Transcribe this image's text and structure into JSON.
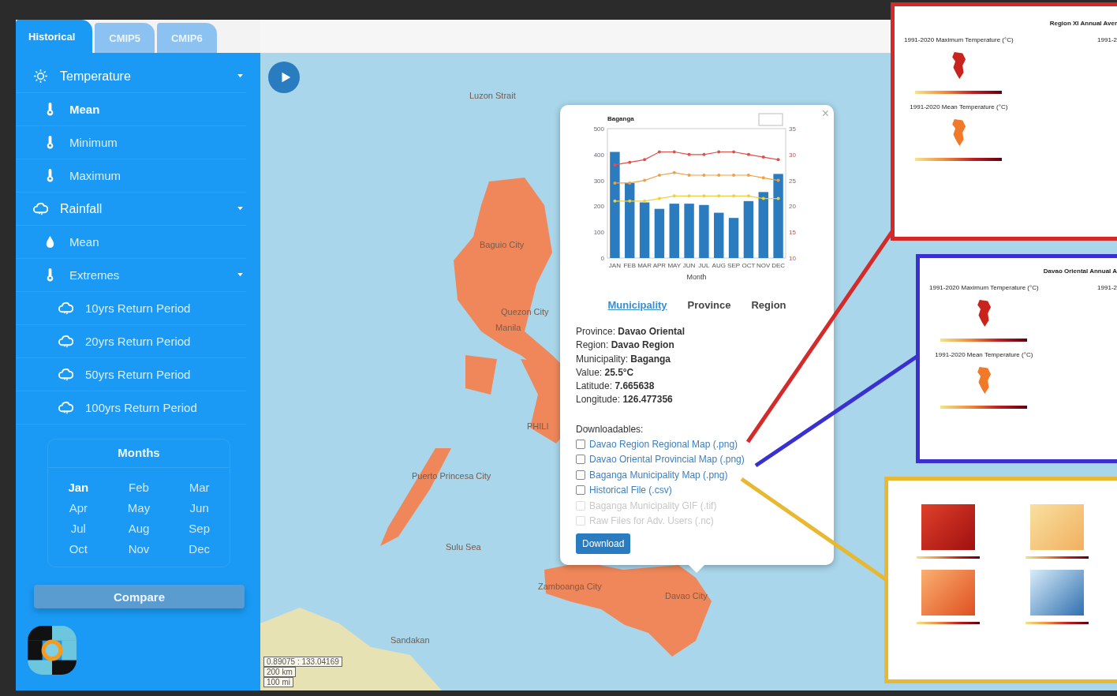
{
  "tabs": [
    {
      "label": "Historical",
      "selected": true
    },
    {
      "label": "CMIP5",
      "selected": false
    },
    {
      "label": "CMIP6",
      "selected": false
    }
  ],
  "sidebar": {
    "menu": [
      {
        "label": "Temperature",
        "selected": false,
        "expanded": true,
        "children": [
          {
            "label": "Mean",
            "selected": true
          },
          {
            "label": "Minimum",
            "selected": false
          },
          {
            "label": "Maximum",
            "selected": false
          }
        ]
      },
      {
        "label": "Rainfall",
        "selected": false,
        "expanded": true,
        "children": [
          {
            "label": "Mean",
            "selected": false
          },
          {
            "label": "Extremes",
            "selected": false,
            "expanded": true,
            "children": [
              {
                "label": "10yrs Return Period",
                "selected": false
              },
              {
                "label": "20yrs Return Period",
                "selected": false
              },
              {
                "label": "50yrs Return Period",
                "selected": false
              },
              {
                "label": "100yrs Return Period",
                "selected": false
              }
            ]
          }
        ]
      }
    ],
    "months_title": "Months",
    "months": [
      {
        "label": "Jan",
        "selected": true
      },
      {
        "label": "Feb",
        "selected": false
      },
      {
        "label": "Mar",
        "selected": false
      },
      {
        "label": "Apr",
        "selected": false
      },
      {
        "label": "May",
        "selected": false
      },
      {
        "label": "Jun",
        "selected": false
      },
      {
        "label": "Jul",
        "selected": false
      },
      {
        "label": "Aug",
        "selected": false
      },
      {
        "label": "Sep",
        "selected": false
      },
      {
        "label": "Oct",
        "selected": false
      },
      {
        "label": "Nov",
        "selected": false
      },
      {
        "label": "Dec",
        "selected": false
      }
    ],
    "compare_button": "Compare"
  },
  "map": {
    "labels": [
      "Luzon Strait",
      "Baguio City",
      "Quezon City",
      "Manila",
      "PHILI",
      "Puerto Princesa City",
      "Sulu Sea",
      "Zamboanga City",
      "Davao City",
      "Sandakan"
    ],
    "scale": {
      "coordinates": "0.89075 : 133.04169",
      "km": "200 km",
      "mi": "100 mi"
    }
  },
  "popup": {
    "close": "×",
    "rainfall": {
      "chart_data": {
        "type": "bar",
        "title": "Baganga",
        "xlabel": "Month",
        "categories": [
          "JAN",
          "FEB",
          "MAR",
          "APR",
          "MAY",
          "JUN",
          "JUL",
          "AUG",
          "SEP",
          "OCT",
          "NOV",
          "DEC"
        ],
        "ylim": [
          0,
          500
        ],
        "yticks": [
          0,
          100,
          200,
          300,
          400,
          500
        ],
        "series": [
          {
            "color": "#2b7bbf",
            "values": [
              410,
              290,
              215,
              190,
              210,
              210,
              205,
              175,
              155,
              220,
              255,
              325
            ]
          }
        ]
      }
    },
    "temperature": {
      "chart_data": {
        "type": "line",
        "ylim": [
          10,
          35
        ],
        "yticks": [
          10,
          15,
          20,
          25,
          30,
          35
        ],
        "series": [
          {
            "color": "#e0504a",
            "values": [
              28,
              28.5,
              29,
              30.5,
              30.5,
              30,
              30,
              30.5,
              30.5,
              30,
              29.5,
              29
            ]
          },
          {
            "color": "#f0a040",
            "values": [
              24.5,
              24.5,
              25,
              26,
              26.5,
              26,
              26,
              26,
              26,
              26,
              25.5,
              25
            ]
          },
          {
            "color": "#f0d040",
            "values": [
              21,
              21,
              21,
              21.5,
              22,
              22,
              22,
              22,
              22,
              22,
              21.5,
              21.5
            ]
          }
        ]
      }
    },
    "tabs": [
      {
        "label": "Municipality",
        "selected": true
      },
      {
        "label": "Province",
        "selected": false
      },
      {
        "label": "Region",
        "selected": false
      }
    ],
    "info": [
      "Province: **Davao Oriental**",
      "Region: **Davao Region**",
      "Municipality: **Baganga**",
      "Value: **25.5°C**",
      "Latitude: **7.665638**",
      "Longitude: **126.477356**"
    ],
    "downloads_title": "Downloadables:",
    "downloads": [
      {
        "label": "Davao Region Regional Map (.png)",
        "checked": false,
        "disabled": false
      },
      {
        "label": "Davao Oriental Provincial Map (.png)",
        "checked": false,
        "disabled": false
      },
      {
        "label": "Baganga Municipality Map (.png)",
        "checked": false,
        "disabled": false
      },
      {
        "label": "Historical File (.csv)",
        "checked": false,
        "disabled": false
      },
      {
        "label": "Baganga Municipality GIF (.tif)",
        "checked": false,
        "disabled": true
      },
      {
        "label": "Raw Files for Adv. Users (.nc)",
        "checked": false,
        "disabled": true
      }
    ],
    "download_button": "Download"
  },
  "callouts": [
    {
      "color": "#d42a2a",
      "title": "Region XI Annual Aver",
      "maps": [
        "1991-2020 Maximum Temperature (°C)",
        "1991-2020 Mean Temperature (°C)"
      ],
      "column_2": "1991-2"
    },
    {
      "color": "#3a2fd0",
      "title": "Davao Oriental Annual A",
      "maps": [
        "1991-2020 Maximum Temperature (°C)",
        "1991-2020 Mean Temperature (°C)"
      ],
      "column_2": "1991-2"
    },
    {
      "color": "#e8b830"
    }
  ]
}
